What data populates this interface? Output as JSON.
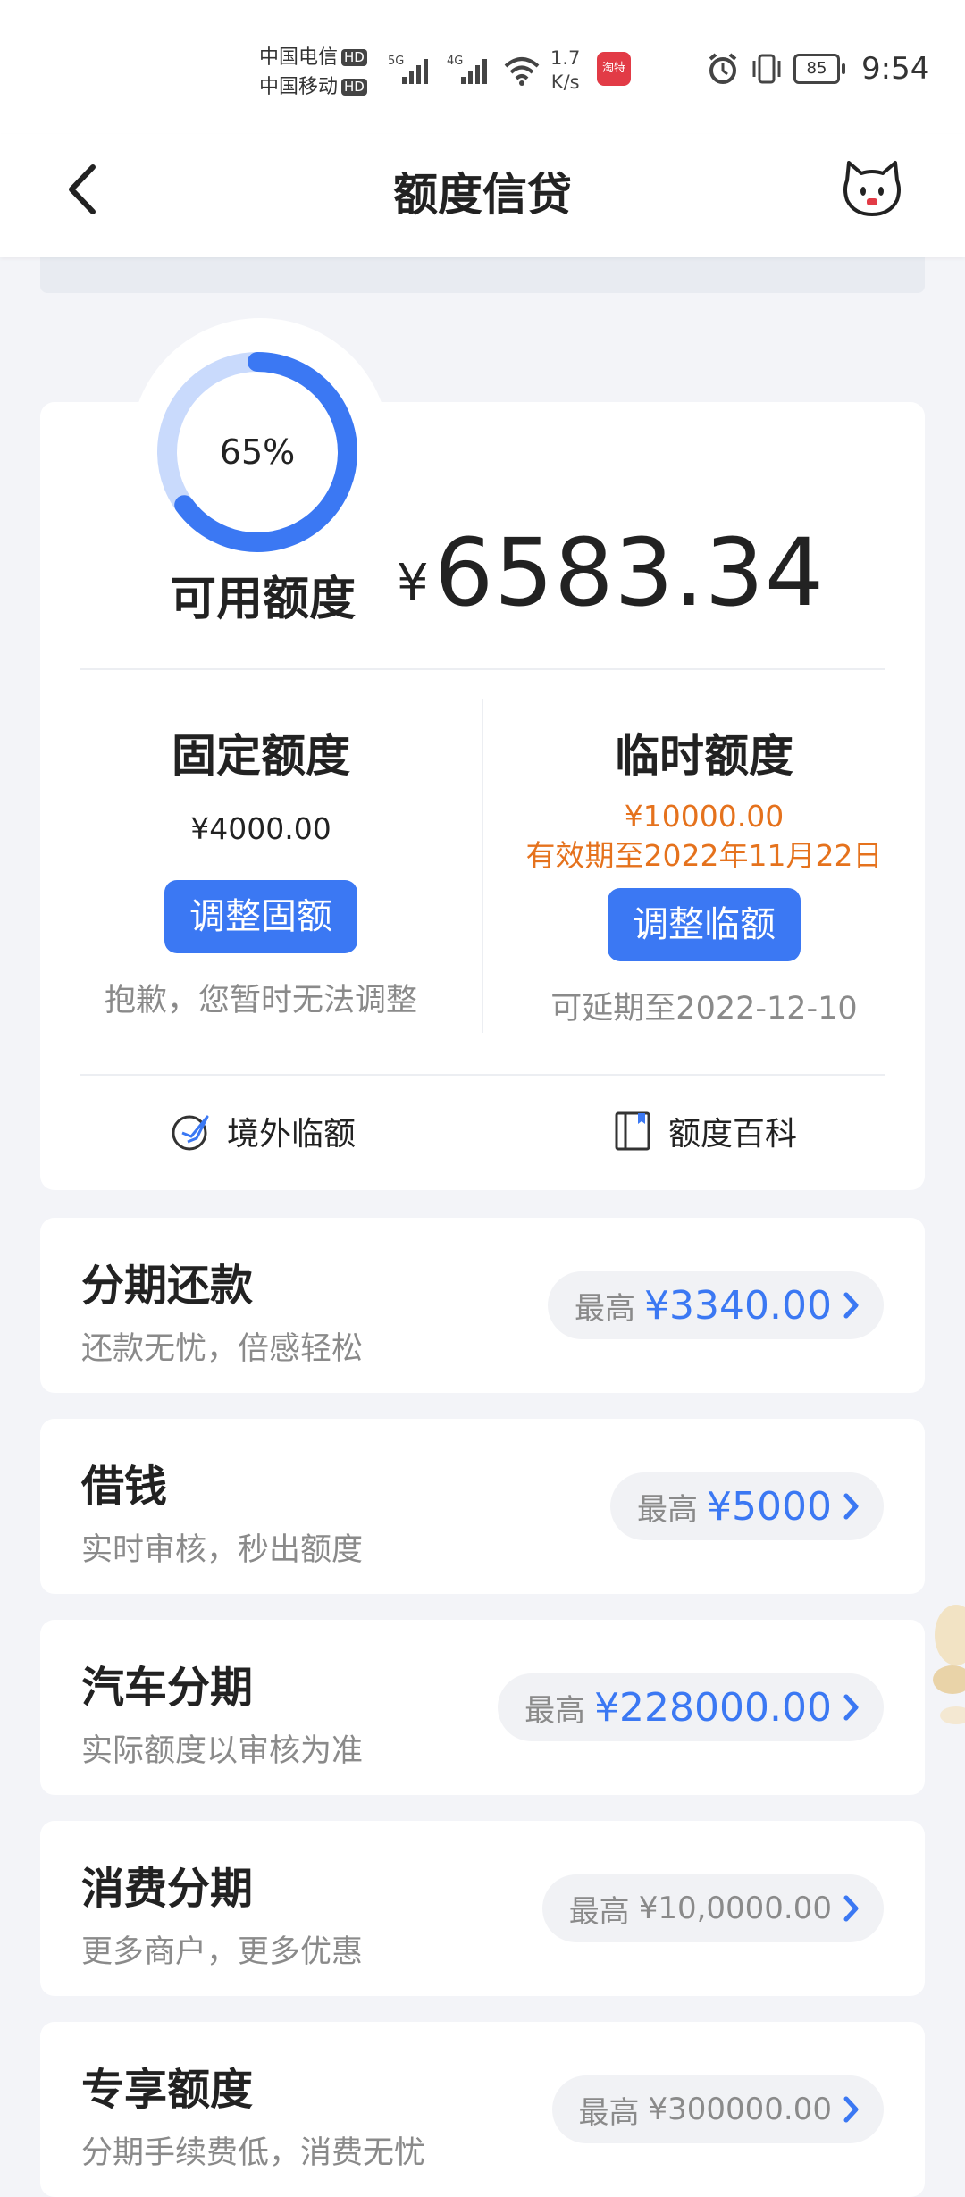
{
  "status_bar": {
    "carrier1": "中国电信",
    "carrier2": "中国移动",
    "hd": "HD",
    "net1": "5G",
    "net2": "4G",
    "speed_value": "1.7",
    "speed_unit": "K/s",
    "app_badge": "淘特",
    "battery": "85",
    "time": "9:54"
  },
  "nav": {
    "title": "额度信贷"
  },
  "quota": {
    "ring_percent_label": "65%",
    "ring_percent": 65,
    "available_label": "可用额度",
    "currency": "¥",
    "available_amount": "6583.34",
    "fixed": {
      "title": "固定额度",
      "amount": "¥4000.00",
      "button": "调整固额",
      "note": "抱歉，您暂时无法调整"
    },
    "temp": {
      "title": "临时额度",
      "amount": "¥10000.00",
      "validity": "有效期至2022年11月22日",
      "button": "调整临额",
      "note": "可延期至2022-12-10"
    },
    "links": {
      "overseas": "境外临额",
      "wiki": "额度百科"
    }
  },
  "services": [
    {
      "title": "分期还款",
      "subtitle": "还款无忧，倍感轻松",
      "prefix": "最高",
      "amount": "¥3340.00"
    },
    {
      "title": "借钱",
      "subtitle": "实时审核，秒出额度",
      "prefix": "最高",
      "amount": "¥5000"
    },
    {
      "title": "汽车分期",
      "subtitle": "实际额度以审核为准",
      "prefix": "最高",
      "amount": "¥228000.00"
    },
    {
      "title": "消费分期",
      "subtitle": "更多商户，更多优惠",
      "prefix": "最高",
      "amount": "¥10,0000.00"
    },
    {
      "title": "专享额度",
      "subtitle": "分期手续费低，消费无忧",
      "prefix": "最高",
      "amount": "¥300000.00"
    }
  ],
  "colors": {
    "accent": "#3b78f3",
    "orange": "#e5721d",
    "ring_track": "#c9dafc"
  },
  "icons": {
    "back": "chevron-left-icon",
    "mascot": "cat-mascot-icon",
    "overseas": "plane-globe-icon",
    "wiki": "book-icon",
    "chevron": "chevron-right-icon"
  }
}
